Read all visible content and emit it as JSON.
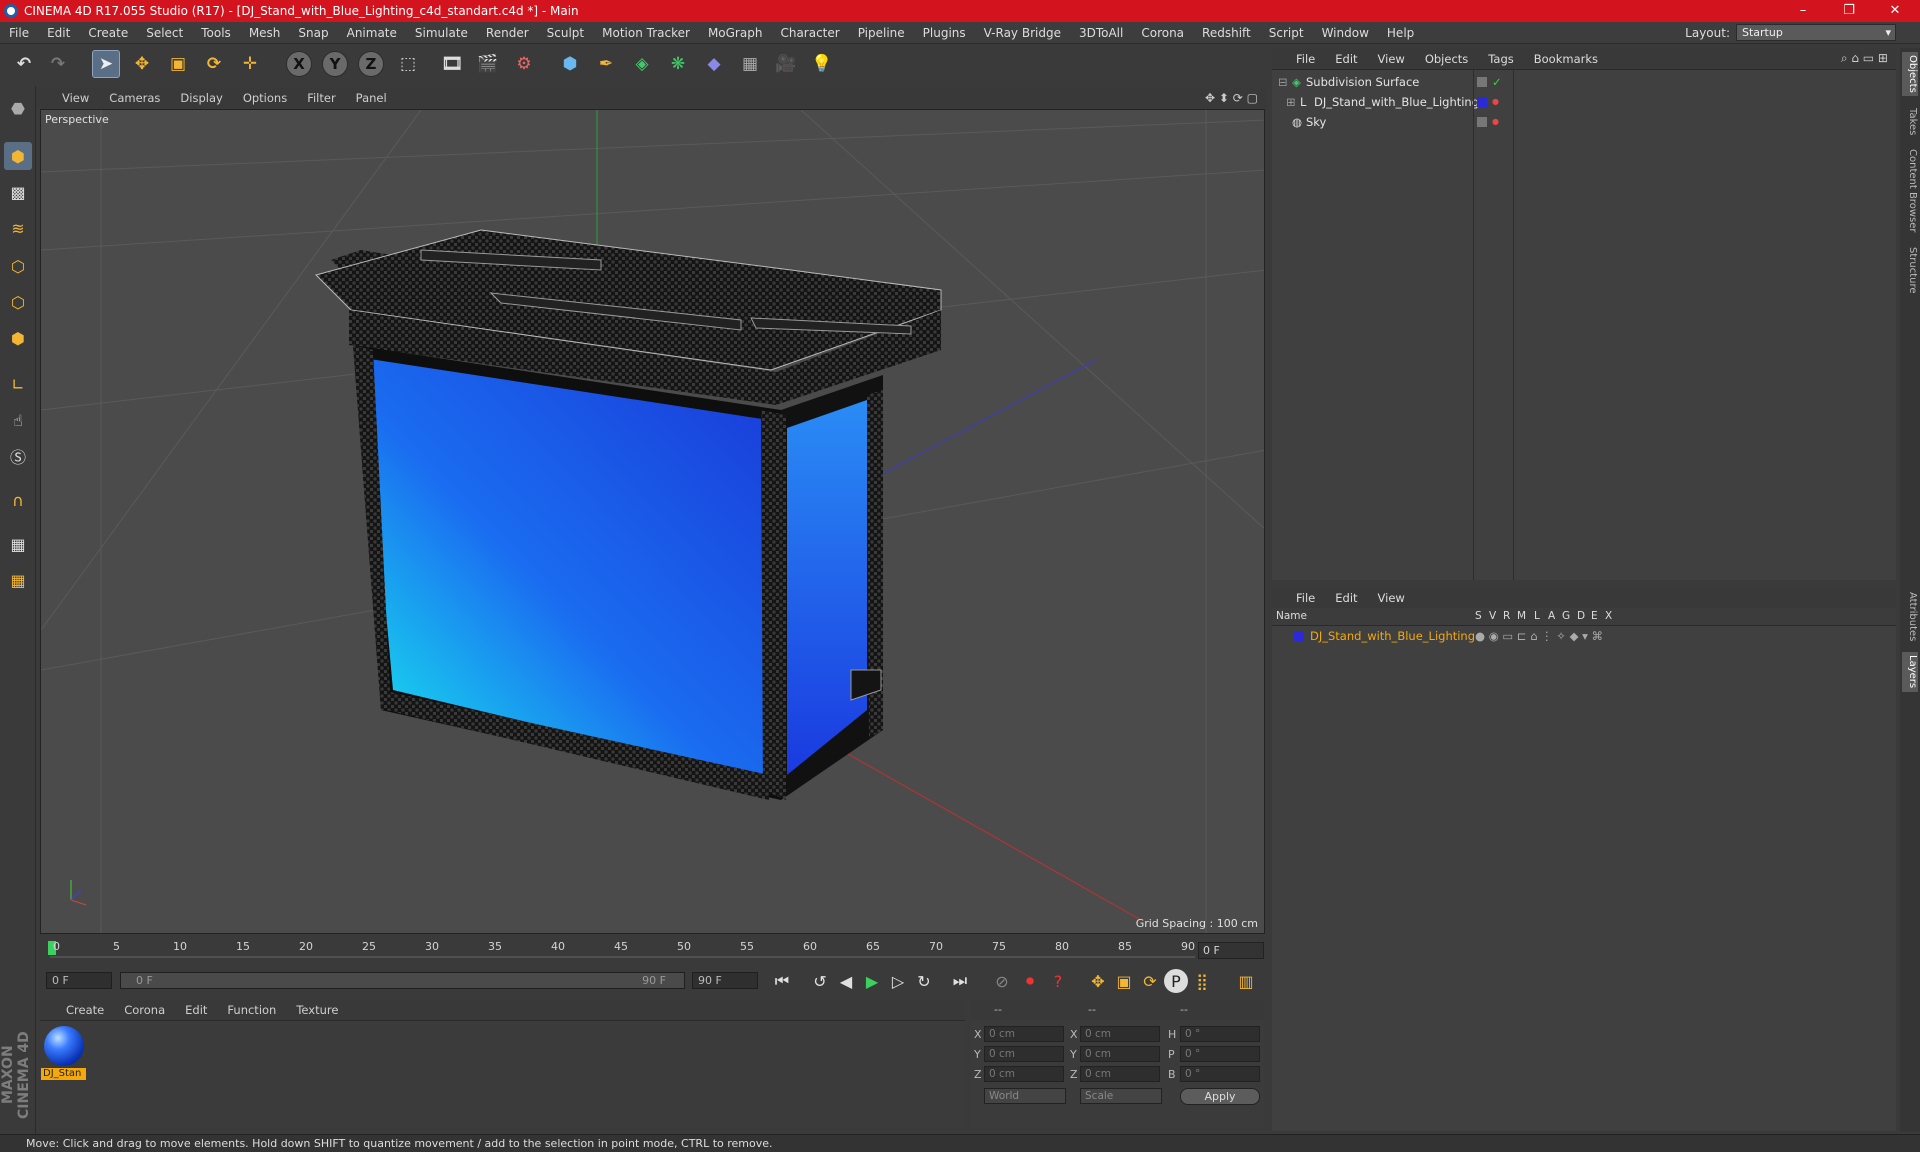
{
  "window": {
    "title": "CINEMA 4D R17.055 Studio (R17) - [DJ_Stand_with_Blue_Lighting_c4d_standart.c4d *] - Main",
    "minimize": "–",
    "restore": "❐",
    "close": "✕"
  },
  "menu": [
    "File",
    "Edit",
    "Create",
    "Select",
    "Tools",
    "Mesh",
    "Snap",
    "Animate",
    "Simulate",
    "Render",
    "Sculpt",
    "Motion Tracker",
    "MoGraph",
    "Character",
    "Pipeline",
    "Plugins",
    "V-Ray Bridge",
    "3DToAll",
    "Corona",
    "Redshift",
    "Script",
    "Window",
    "Help"
  ],
  "layout": {
    "label": "Layout:",
    "value": "Startup"
  },
  "viewport": {
    "menu": [
      "View",
      "Cameras",
      "Display",
      "Options",
      "Filter",
      "Panel"
    ],
    "label": "Perspective",
    "grid_spacing": "Grid Spacing : 100 cm"
  },
  "timeline": {
    "ticks": [
      "0",
      "5",
      "10",
      "15",
      "20",
      "25",
      "30",
      "35",
      "40",
      "45",
      "50",
      "55",
      "60",
      "65",
      "70",
      "75",
      "80",
      "85",
      "90"
    ],
    "current_frame": "0 F",
    "start_field": "0 F",
    "range_start": "0 F",
    "range_end": "90 F",
    "end_field": "90 F"
  },
  "material_manager": {
    "menu": [
      "Create",
      "Corona",
      "Edit",
      "Function",
      "Texture"
    ],
    "material_name": "DJ_Stan"
  },
  "coordinates": {
    "headers": [
      "--",
      "--",
      "--"
    ],
    "rows": [
      {
        "a": "X",
        "av": "0 cm",
        "b": "X",
        "bv": "0 cm",
        "c": "H",
        "cv": "0 °"
      },
      {
        "a": "Y",
        "av": "0 cm",
        "b": "Y",
        "bv": "0 cm",
        "c": "P",
        "cv": "0 °"
      },
      {
        "a": "Z",
        "av": "0 cm",
        "b": "Z",
        "bv": "0 cm",
        "c": "B",
        "cv": "0 °"
      }
    ],
    "mode": "World",
    "scale": "Scale",
    "apply": "Apply"
  },
  "status": "Move: Click and drag to move elements. Hold down SHIFT to quantize movement / add to the selection in point mode, CTRL to remove.",
  "object_manager": {
    "menu": [
      "File",
      "Edit",
      "View",
      "Objects",
      "Tags",
      "Bookmarks"
    ],
    "objects": [
      {
        "name": "Subdivision Surface"
      },
      {
        "name": "DJ_Stand_with_Blue_Lighting"
      },
      {
        "name": "Sky"
      }
    ]
  },
  "layer_manager": {
    "menu": [
      "File",
      "Edit",
      "View"
    ],
    "columns": [
      "Name",
      "S",
      "V",
      "R",
      "M",
      "L",
      "A",
      "G",
      "D",
      "E",
      "X"
    ],
    "layers": [
      {
        "name": "DJ_Stand_with_Blue_Lighting",
        "color": "#2a2ad8"
      }
    ]
  },
  "right_tabs": [
    "Objects",
    "Takes",
    "Content Browser",
    "Structure",
    "Attributes",
    "Layers"
  ],
  "colors": {
    "titlebar": "#d3131d",
    "accent": "#f5a80a",
    "selection": "#5a6f86"
  }
}
